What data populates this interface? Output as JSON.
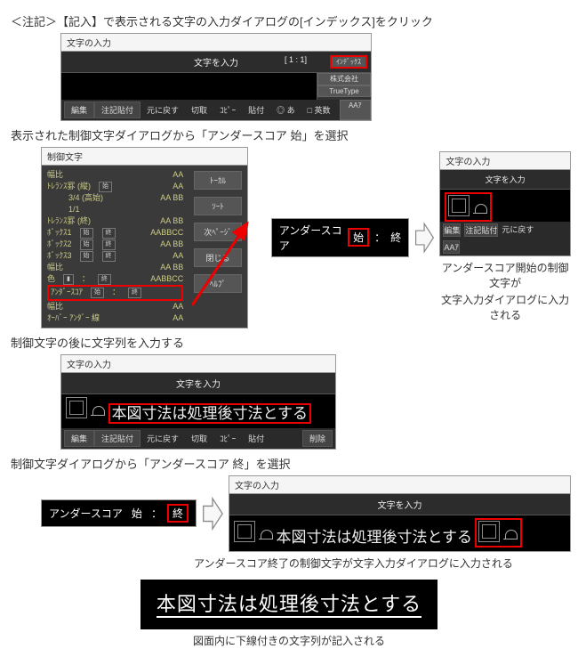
{
  "step1": "＜注記＞【記入】で表示される文字の入力ダイアログの[インデックス]をクリック",
  "step2": "表示された制御文字ダイアログから「アンダースコア 始」を選択",
  "step3": "制御文字の後に文字列を入力する",
  "step4": "制御文字ダイアログから「アンダースコア 終」を選択",
  "caption_a": "アンダースコア開始の制御文字が",
  "caption_a2": "文字入力ダイアログに入力される",
  "caption_b": "アンダースコア終了の制御文字が文字入力ダイアログに入力される",
  "caption_c": "図面内に下線付きの文字列が記入される",
  "dialog": {
    "title_text_input": "文字の入力",
    "title_ctrl": "制御文字",
    "header_input": "文字を入力",
    "counter": "[ 1 : 1]",
    "btn_index": "ｲﾝﾃﾞｯｸｽ",
    "btn_release": "株式会社",
    "btn_truetype": "TrueType",
    "btn_aa": "AAｱ"
  },
  "toolbar": {
    "edit": "編集",
    "paste": "注記貼付",
    "undo": "元に戻す",
    "cut": "切取",
    "copy": "ｺﾋﾟｰ",
    "paste2": "貼付",
    "circle": "◎ あ",
    "checks": "□ 英数",
    "delete": "削除"
  },
  "side": {
    "all": "ﾄｰｶﾙ",
    "sort": "ｿｰﾄ",
    "page": "次ﾍﾟｰｼﾞ",
    "close": "閉じる",
    "help": "ﾍﾙﾌﾟ"
  },
  "ctrl_list": {
    "r1": "幅比",
    "r2a": "ﾄﾚﾗﾝｽ罫 (縦)",
    "r2b": "3/4 (高始)",
    "r2c": "1/1",
    "r3": "ﾄﾚﾗﾝｽ罫 (終)",
    "r4": "ﾎﾞｯｸｽ1",
    "r5": "ﾎﾞｯｸｽ2",
    "r6": "ﾎﾞｯｸｽ3",
    "r7": "幅比",
    "r8": "色",
    "r9": "ｱﾝﾀﾞｰｽｺｱ",
    "r10": "幅比",
    "r11": "ｵｰﾊﾞｰ ｱﾝﾀﾞｰ 線",
    "AA": "AA",
    "AABB": "AA BB",
    "AABBCC": "AABBCC",
    "label_begin": "始",
    "label_end": "終",
    "sep": "："
  },
  "underscore_target": "アンダースコア",
  "sample_text": "本図寸法は処理後寸法とする"
}
